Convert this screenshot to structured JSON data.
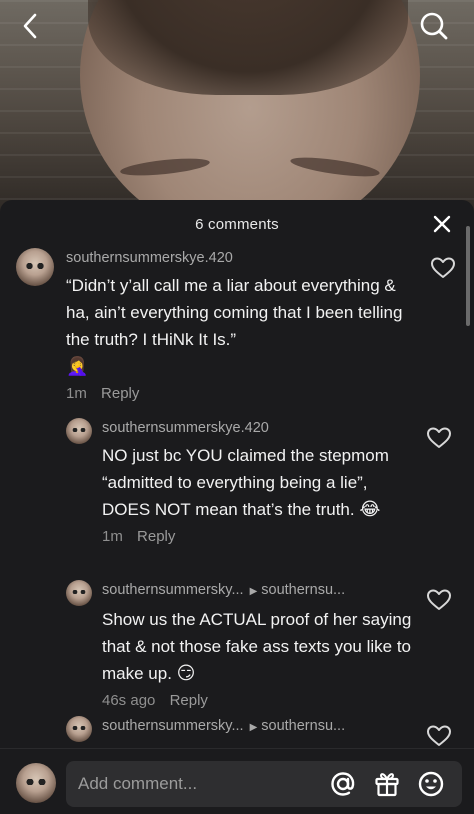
{
  "header": {
    "comment_count": "6 comments"
  },
  "icons": {
    "back": "back-chevron-icon",
    "search": "search-icon",
    "close": "close-icon",
    "like": "heart-outline-icon",
    "mention": "at-sign-icon",
    "gift": "gift-icon",
    "emoji": "smiley-icon"
  },
  "comments": [
    {
      "username": "southernsummerskye.420",
      "text": "“Didn’t y’all call me a liar about everything & ha, ain’t everything coming that I been telling the truth? I tHiNk It Is.”",
      "emoji": "🤦‍♀️",
      "time": "1m",
      "reply": "Reply"
    }
  ],
  "replies": [
    {
      "username": "southernsummerskye.420",
      "reply_to": "",
      "text": "NO just bc YOU claimed the stepmom “admitted to everything being a lie”, DOES NOT mean that’s the truth.",
      "emoji": "😂",
      "time": "1m",
      "reply": "Reply"
    },
    {
      "username": "southernsummersky...",
      "reply_to": "southernsu...",
      "text": "Show us the ACTUAL proof of her saying that & not those fake ass texts you like to make up.",
      "emoji": "😏",
      "time": "46s ago",
      "reply": "Reply"
    },
    {
      "username": "southernsummersky...",
      "reply_to": "southernsu..."
    }
  ],
  "input": {
    "placeholder": "Add comment..."
  },
  "colors": {
    "sheet_bg": "#1b1b1d",
    "input_bg": "#2e2e30",
    "username": "#a9a9a9",
    "text": "#f2f2f2"
  }
}
